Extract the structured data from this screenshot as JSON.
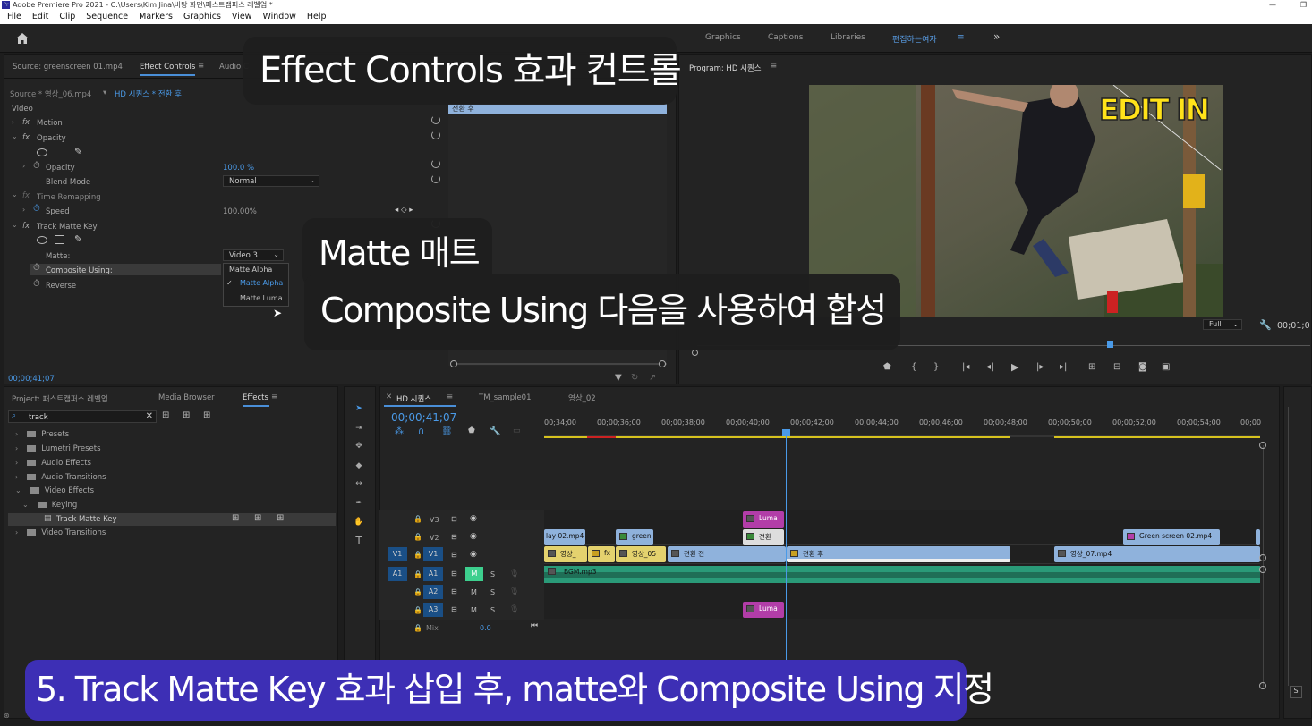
{
  "window": {
    "title": "Adobe Premiere Pro 2021 - C:\\Users\\Kim Jina\\바탕 화면\\패스트캠퍼스 레벨업 *"
  },
  "menu": [
    "File",
    "Edit",
    "Clip",
    "Sequence",
    "Markers",
    "Graphics",
    "View",
    "Window",
    "Help"
  ],
  "workspaces": {
    "items": [
      "Graphics",
      "Captions",
      "Libraries"
    ],
    "active": "편집하는여자",
    "more": "»"
  },
  "source_panel": {
    "tab_source": "Source: greenscreen 01.mp4",
    "tab_effect": "Effect Controls",
    "tab_audio": "Audio C",
    "source_clip": "Source * 영상_06.mp4",
    "sequence_clip": "HD 시퀀스 * 전환 후",
    "mini_clip": "전환 후",
    "timecode": "00;00;41;07"
  },
  "effect_controls": {
    "video_label": "Video",
    "motion": "Motion",
    "opacity": "Opacity",
    "opacity_label": "Opacity",
    "opacity_value": "100.0 %",
    "blend_label": "Blend Mode",
    "blend_value": "Normal",
    "time_remap": "Time Remapping",
    "speed_label": "Speed",
    "speed_value": "100.00%",
    "tmk": "Track Matte Key",
    "matte_label": "Matte:",
    "matte_value": "Video 3",
    "composite_label": "Composite Using:",
    "composite_value": "Matte Alpha",
    "reverse_label": "Reverse",
    "dropdown": {
      "items": [
        "Matte Alpha",
        "Matte Luma"
      ],
      "checked": "Matte Alpha"
    }
  },
  "program": {
    "title": "Program: HD 시퀀스",
    "overlay_text": "EDIT IN",
    "zoom": "Full",
    "timecode": "00;01;0"
  },
  "project_panel": {
    "tab_project": "Project: 패스트캠퍼스 레벨업",
    "tab_media": "Media Browser",
    "tab_effects": "Effects",
    "search_value": "track",
    "tree": [
      {
        "label": "Presets",
        "level": 0
      },
      {
        "label": "Lumetri Presets",
        "level": 0
      },
      {
        "label": "Audio Effects",
        "level": 0
      },
      {
        "label": "Audio Transitions",
        "level": 0
      },
      {
        "label": "Video Effects",
        "level": 0
      },
      {
        "label": "Keying",
        "level": 1
      },
      {
        "label": "Track Matte Key",
        "level": 2
      },
      {
        "label": "Video Transitions",
        "level": 0
      }
    ]
  },
  "timeline": {
    "tab_active": "HD 시퀀스",
    "tab_2": "TM_sample01",
    "tab_3": "영상_02",
    "timecode": "00;00;41;07",
    "ruler": [
      "00;34;00",
      "00;00;36;00",
      "00;00;38;00",
      "00;00;40;00",
      "00;00;42;00",
      "00;00;44;00",
      "00;00;46;00",
      "00;00;48;00",
      "00;00;50;00",
      "00;00;52;00",
      "00;00;54;00",
      "00;00"
    ],
    "tracks": {
      "v3": "V3",
      "v2": "V2",
      "v1": "V1",
      "a1": "A1",
      "a2": "A2",
      "a3": "A3",
      "mix": "Mix",
      "mix_value": "0.0",
      "m": "M",
      "s": "S"
    },
    "clips": {
      "luma": "Luma",
      "jeonhwan": "전환",
      "green": "green",
      "lay02": "lay 02.mp4",
      "green02": "Green screen 02.mp4",
      "young_a": "영상_",
      "young_05": "영상_05",
      "jeonhwan_jeon": "전환 전",
      "jeonhwan_hu": "전환 후",
      "young_07": "영상_07.mp4",
      "bgm": "BGM.mp3",
      "fx": "fx"
    }
  },
  "captions": {
    "c1": "Effect Controls  효과 컨트롤",
    "c2": "Matte 매트",
    "c3": "Composite Using 다음을 사용하여 합성",
    "c4": "5. Track Matte Key 효과 삽입 후, matte와 Composite Using 지정"
  },
  "colors": {
    "accent": "#4a9ae8",
    "caption_bottom": "#3d2fb5",
    "panel_bg": "#232323"
  }
}
